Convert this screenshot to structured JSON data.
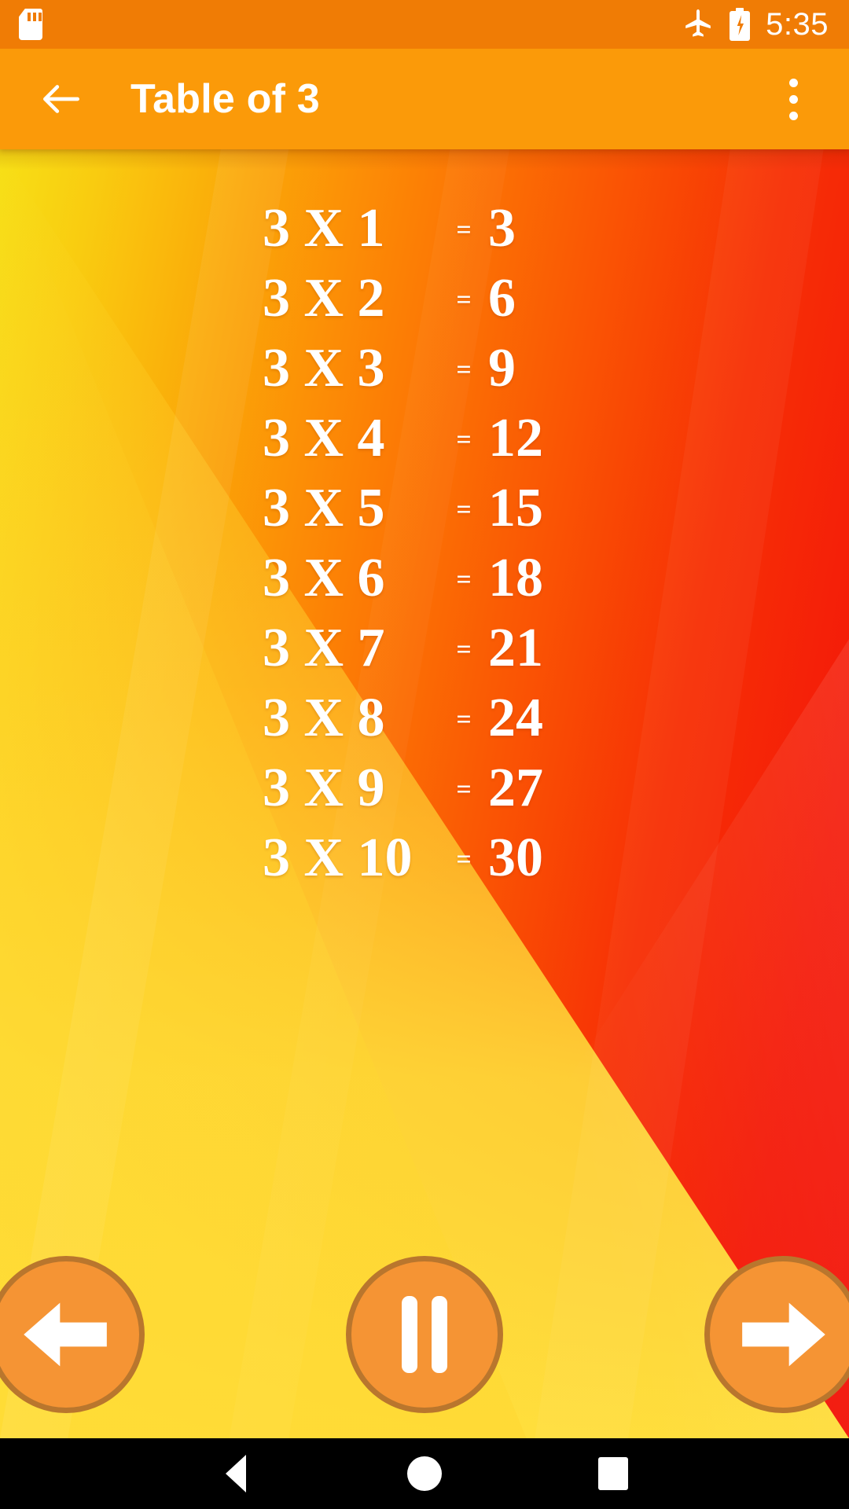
{
  "status_bar": {
    "sd_card_icon": "sd-card-icon",
    "airplane_icon": "airplane-mode-icon",
    "battery_icon": "battery-charging-icon",
    "time": "5:35",
    "background_color": "#F07C05"
  },
  "app_bar": {
    "back_icon": "back-arrow-icon",
    "title": "Table of 3",
    "overflow_icon": "overflow-menu-icon",
    "background_color": "#FB9A09",
    "text_color": "#FFFFFF"
  },
  "wallpaper": {
    "gradient_from": "#F7E016",
    "gradient_to": "#F21207",
    "accent_yellow": "#FFE23E"
  },
  "table": {
    "multiplicand": "3",
    "operator": "X",
    "equals": "=",
    "rows": [
      {
        "expr": "3 X 1",
        "eq": "=",
        "product": "3"
      },
      {
        "expr": "3 X 2",
        "eq": "=",
        "product": "6"
      },
      {
        "expr": "3 X 3",
        "eq": "=",
        "product": "9"
      },
      {
        "expr": "3 X 4",
        "eq": "=",
        "product": "12"
      },
      {
        "expr": "3 X 5",
        "eq": "=",
        "product": "15"
      },
      {
        "expr": "3 X 6",
        "eq": "=",
        "product": "18"
      },
      {
        "expr": "3 X 7",
        "eq": "=",
        "product": "21"
      },
      {
        "expr": "3 X 8",
        "eq": "=",
        "product": "24"
      },
      {
        "expr": "3 X 9",
        "eq": "=",
        "product": "27"
      },
      {
        "expr": "3 X 10",
        "eq": "=",
        "product": "30"
      }
    ]
  },
  "controls": {
    "previous_icon": "left-arrow-icon",
    "pause_icon": "pause-icon",
    "next_icon": "right-arrow-icon",
    "button_fill": "#F59434",
    "button_border": "#B9762D",
    "icon_color": "#FFFFFF"
  },
  "nav_bar": {
    "back_icon": "nav-back-triangle-icon",
    "home_icon": "nav-home-circle-icon",
    "recents_icon": "nav-recents-square-icon",
    "background_color": "#000000"
  }
}
